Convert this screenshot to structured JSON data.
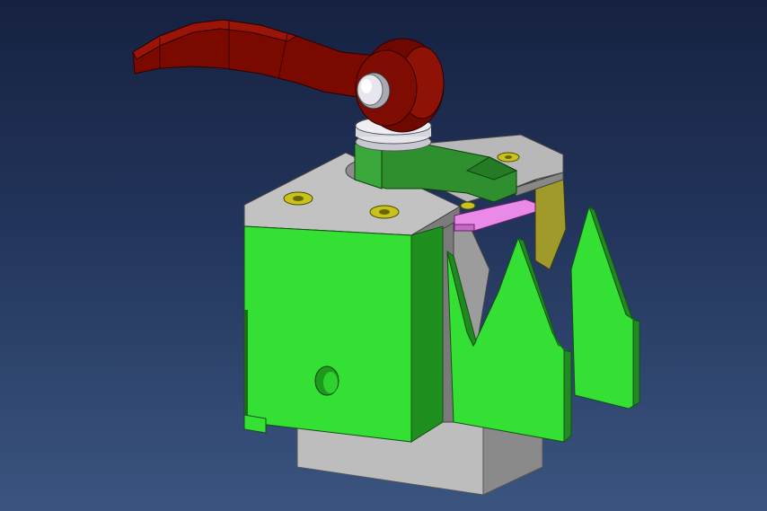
{
  "viewport": {
    "background_top": "#162140",
    "background_bottom": "#3a5580"
  },
  "model": {
    "parts": [
      {
        "name": "cam-lever",
        "color": "#7a0a00"
      },
      {
        "name": "lever-pivot-pin",
        "color": "#d8d8e0"
      },
      {
        "name": "clamp-arm",
        "color": "#2f8f2f"
      },
      {
        "name": "top-plate",
        "color": "#b9b9b9"
      },
      {
        "name": "fixture-block",
        "color": "#35e035"
      },
      {
        "name": "saw-tooth-jaw",
        "color": "#35e035"
      },
      {
        "name": "jaw-pad",
        "color": "#e98ae9"
      },
      {
        "name": "side-guide",
        "color": "#a09a2a"
      },
      {
        "name": "base-block",
        "color": "#bdbdbd"
      },
      {
        "name": "mounting-screw",
        "color": "#c9c21a"
      },
      {
        "name": "side-hole",
        "color": "#1d9a1d"
      }
    ]
  }
}
